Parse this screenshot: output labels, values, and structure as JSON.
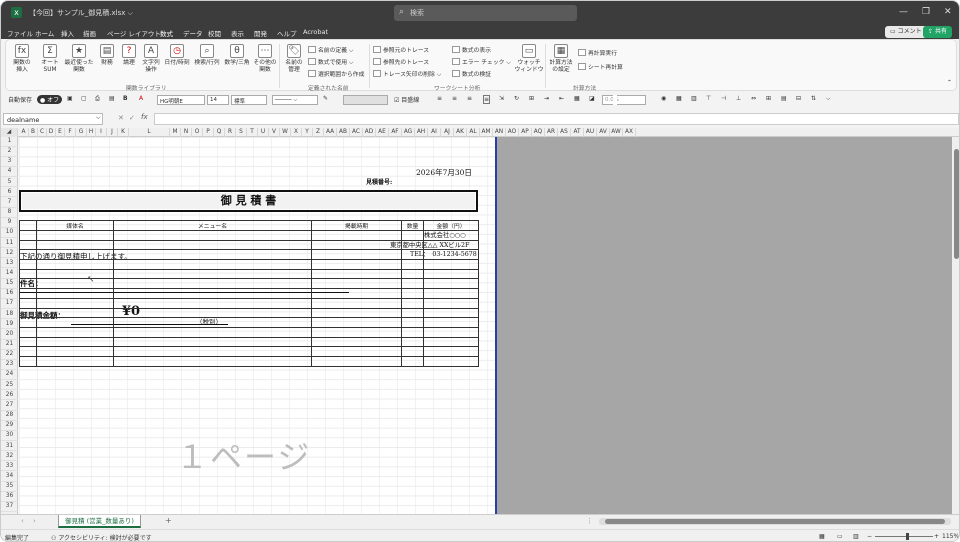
{
  "titlebar": {
    "filename": "【今回】サンプル_御見積.xlsx",
    "filename_suffix": "⌵",
    "search_placeholder": "検索"
  },
  "menu": {
    "items": [
      "ファイル",
      "ホーム",
      "挿入",
      "描画",
      "ページ レイアウト",
      "数式",
      "データ",
      "校閲",
      "表示",
      "開発",
      "ヘルプ",
      "Acrobat"
    ],
    "active": "数式",
    "comment": "コメント",
    "share": "共有"
  },
  "ribbon": {
    "func_group": [
      {
        "label": "関数の\n挿入",
        "icon": "fx"
      },
      {
        "label": "オート\nSUM",
        "icon": "Σ"
      },
      {
        "label": "最近使った\n関数",
        "icon": "★"
      },
      {
        "label": "財務",
        "icon": "▤"
      },
      {
        "label": "論理",
        "icon": "?"
      },
      {
        "label": "文字列\n操作",
        "icon": "A"
      },
      {
        "label": "日付/時刻",
        "icon": "◷"
      },
      {
        "label": "検索/行列",
        "icon": "⌕"
      },
      {
        "label": "数学/三角",
        "icon": "θ"
      },
      {
        "label": "その他の\n関数",
        "icon": "⋯"
      }
    ],
    "func_group_label": "関数ライブラリ",
    "names": {
      "manager": "名前の\n管理",
      "define": "名前の定義",
      "use": "数式で使用",
      "create": "選択範囲から作成",
      "label": "定義された名前"
    },
    "audit": {
      "trace_prec": "参照元のトレース",
      "trace_dep": "参照先のトレース",
      "remove": "トレース矢印の削除",
      "show": "数式の表示",
      "error": "エラー チェック",
      "eval": "数式の検証",
      "watch": "ウォッチ\nウィンドウ",
      "label": "ワークシート分析"
    },
    "calc": {
      "options": "計算方法\nの設定",
      "now": "再計算実行",
      "sheet": "シート再計算",
      "label": "計算方法"
    }
  },
  "qat": {
    "autosave": "自動保存",
    "autosave_state": "オフ",
    "font": "HG明朝E",
    "size": "14",
    "style": "標準",
    "gridlines": "目盛線",
    "zoom1": "0.0%",
    "zoom2": "0.0%"
  },
  "formulabar": {
    "namebox": "dealname",
    "fx": "fx",
    "formula": ""
  },
  "columns": [
    "A",
    "B",
    "C",
    "D",
    "E",
    "F",
    "G",
    "H",
    "I",
    "J",
    "K",
    "L",
    "M",
    "N",
    "O",
    "P",
    "Q",
    "R",
    "S",
    "T",
    "U",
    "V",
    "W",
    "X",
    "Y",
    "Z",
    "AA",
    "AB",
    "AC",
    "AD",
    "AE",
    "AF",
    "AG",
    "AH",
    "AI",
    "AJ",
    "AK",
    "AL",
    "AM",
    "AN",
    "AO",
    "AP",
    "AQ",
    "AR",
    "AS",
    "AT",
    "AU",
    "AV",
    "AW",
    "AX"
  ],
  "rows": [
    "1",
    "2",
    "3",
    "4",
    "5",
    "6",
    "7",
    "8",
    "9",
    "10",
    "11",
    "12",
    "13",
    "14",
    "15",
    "16",
    "17",
    "18",
    "19",
    "20",
    "21",
    "22",
    "23",
    "24",
    "25",
    "26",
    "27",
    "28",
    "29",
    "30",
    "31",
    "32",
    "33",
    "34",
    "35",
    "36",
    "37"
  ],
  "doc": {
    "date": "2026年7月30日",
    "quote_no_label": "見積番号:",
    "title": "御 見 積 書",
    "company": "株式会社○○○",
    "address": "東京都中央区△△ XXビル2F",
    "tel": "TEL：　03-1234-5678",
    "intro": "下記の通り御見積申し上げます。",
    "subject_label": "件名：",
    "amount_label": "御見積金額：",
    "amount": "¥0",
    "tax": "（税別）",
    "watermark": "１ページ",
    "table_headers": [
      "媒体名",
      "メニュー名",
      "掲載時期",
      "数量",
      "金額（円）"
    ]
  },
  "sheettab": {
    "name": "御見積 (営業_数量あり)",
    "add": "+"
  },
  "status": {
    "mode": "編集完了",
    "accessibility": "アクセシビリティ: 検討が必要です",
    "zoom": "115%"
  }
}
